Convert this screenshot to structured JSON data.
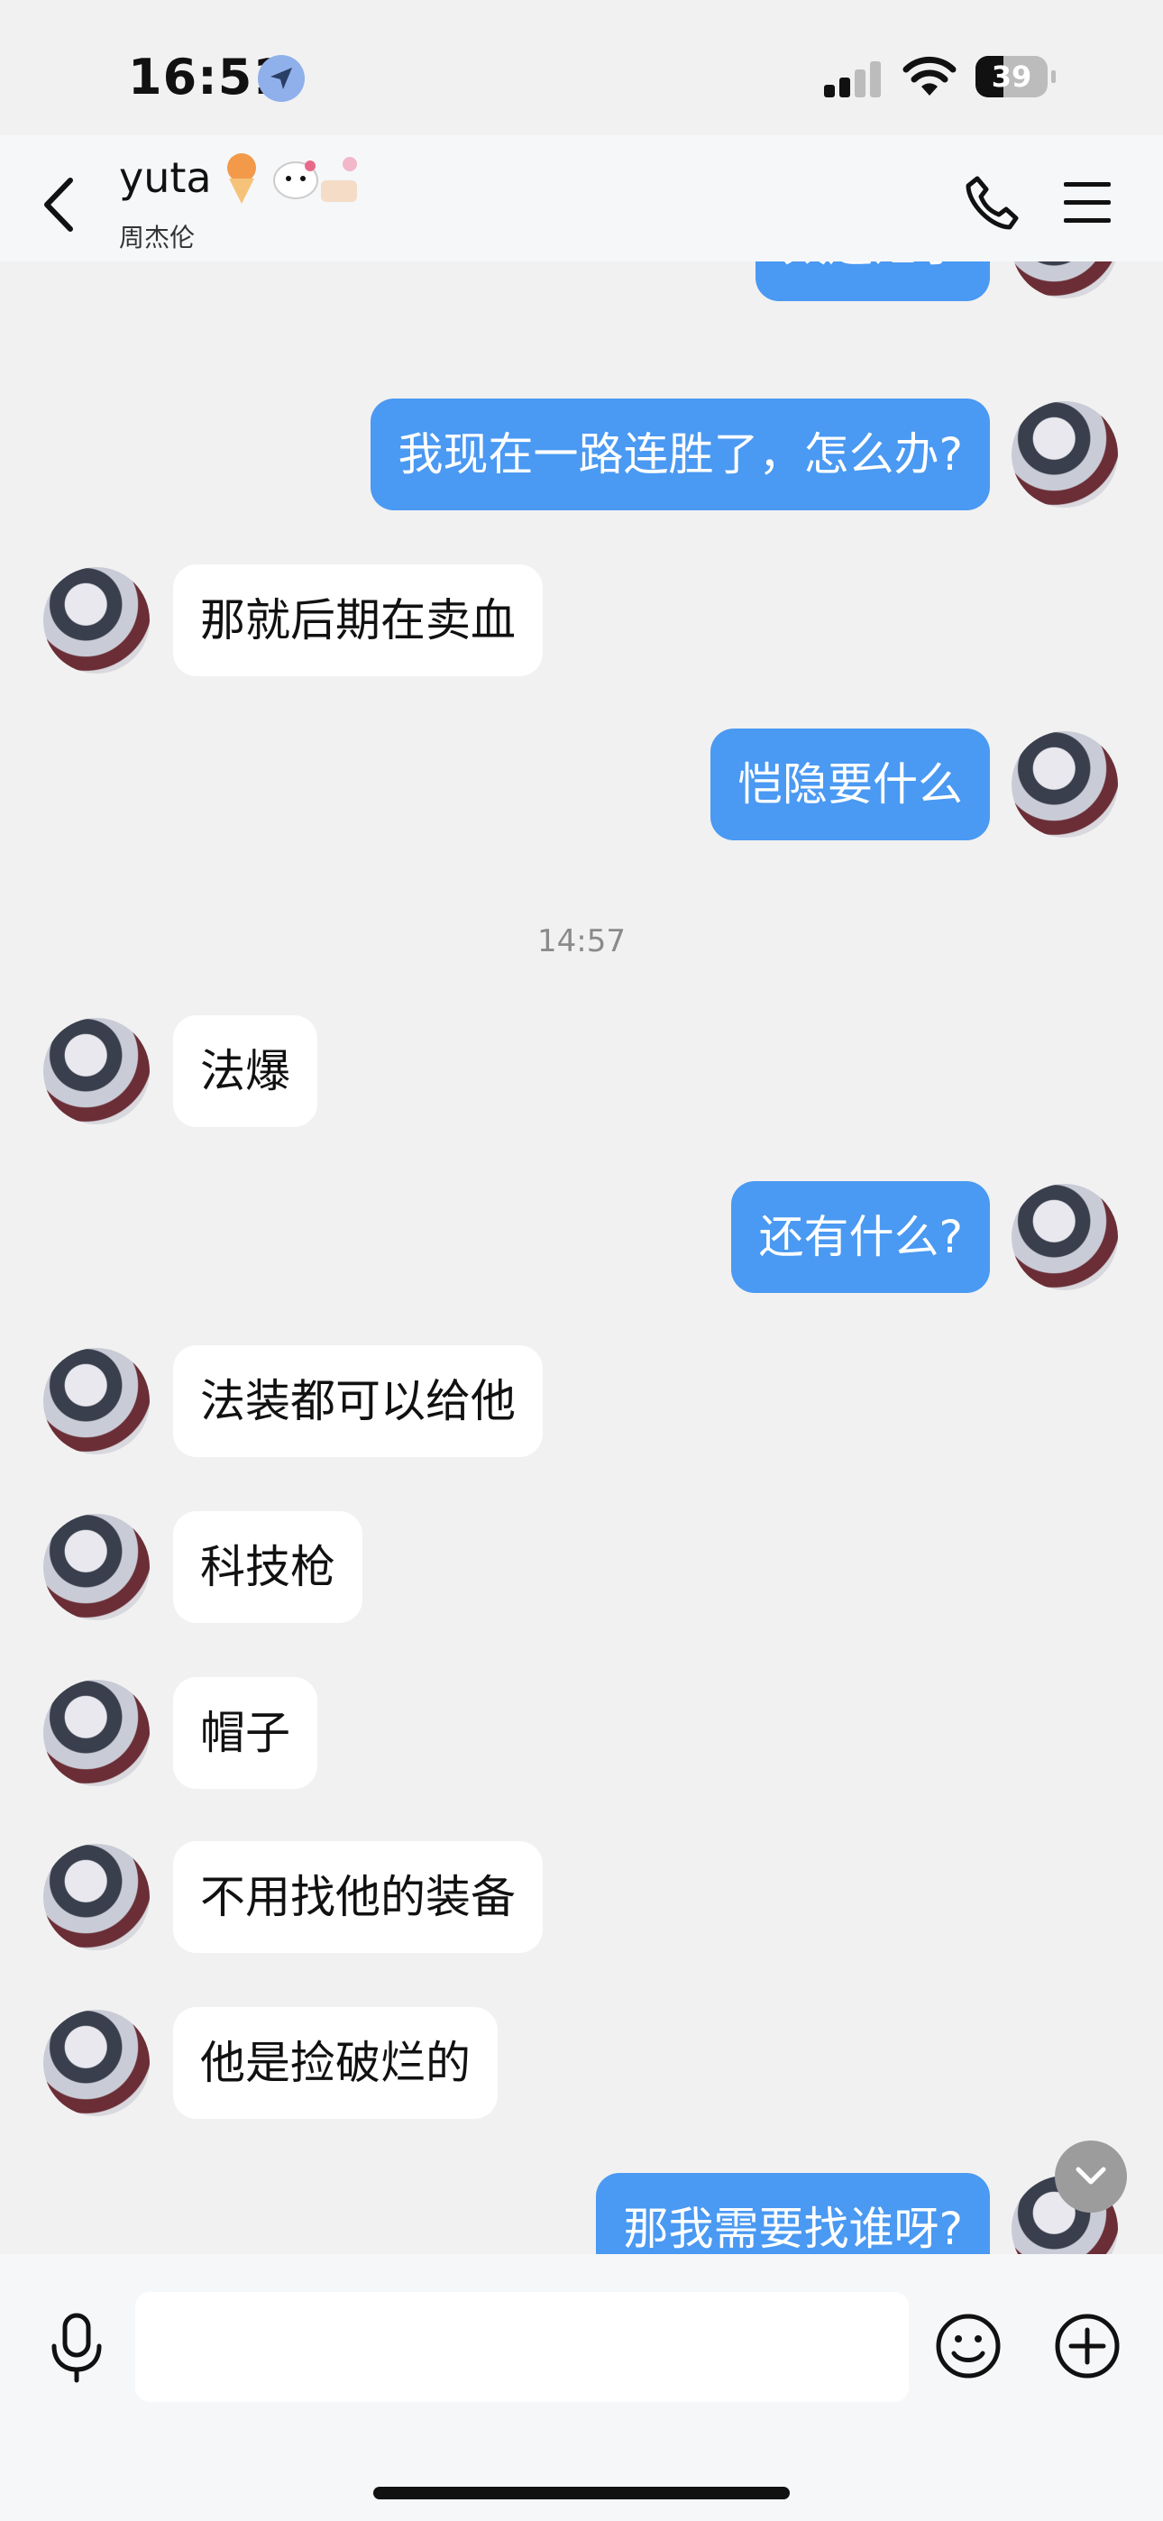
{
  "status_bar": {
    "time": "16:51",
    "battery": "39",
    "battery_level": 0.39
  },
  "header": {
    "contact_name": "yuta",
    "contact_subtitle": "周杰伦"
  },
  "messages": [
    {
      "side": "me",
      "text": "太迷茫了"
    },
    {
      "side": "me",
      "text": "我现在一路连胜了，怎么办?"
    },
    {
      "side": "other",
      "text": "那就后期在卖血"
    },
    {
      "side": "me",
      "text": "恺隐要什么"
    },
    {
      "timestamp": "14:57"
    },
    {
      "side": "other",
      "text": "法爆"
    },
    {
      "side": "me",
      "text": "还有什么?"
    },
    {
      "side": "other",
      "text": "法装都可以给他"
    },
    {
      "side": "other",
      "text": "科技枪"
    },
    {
      "side": "other",
      "text": "帽子"
    },
    {
      "side": "other",
      "text": "不用找他的装备"
    },
    {
      "side": "other",
      "text": "他是捡破烂的"
    },
    {
      "side": "me",
      "text": "那我需要找谁呀?"
    }
  ],
  "input": {
    "value": "",
    "placeholder": ""
  },
  "icons": {
    "back": "chevron-left-icon",
    "phone": "phone-icon",
    "menu": "menu-icon",
    "mic": "microphone-icon",
    "emoji": "emoji-icon",
    "plus": "plus-circle-icon",
    "scroll": "chevron-down-icon",
    "location": "location-arrow-icon"
  },
  "colors": {
    "my_bubble": "#4a99f2",
    "other_bubble": "#ffffff",
    "background": "#f1f1f1"
  }
}
